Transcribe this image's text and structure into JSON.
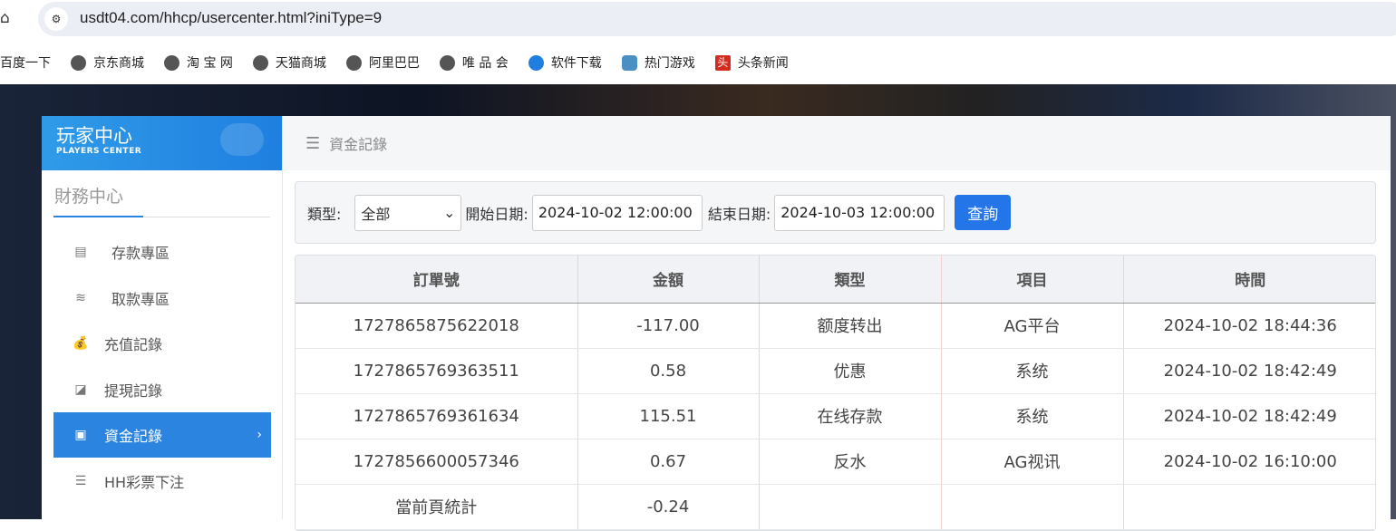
{
  "browser": {
    "url": "usdt04.com/hhcp/usercenter.html?iniType=9",
    "bookmarks": [
      "百度一下",
      "京东商城",
      "淘 宝 网",
      "天猫商城",
      "阿里巴巴",
      "唯 品 会",
      "软件下载",
      "热门游戏",
      "头条新闻"
    ]
  },
  "sidebar": {
    "brand_title": "玩家中心",
    "brand_sub": "PLAYERS CENTER",
    "section": "財務中心",
    "items": [
      {
        "label": "存款專區",
        "icon": "card-icon"
      },
      {
        "label": "取款專區",
        "icon": "hand-cash-icon"
      },
      {
        "label": "充值記錄",
        "icon": "money-bag-icon"
      },
      {
        "label": "提現記錄",
        "icon": "wallet-icon"
      },
      {
        "label": "資金記錄",
        "icon": "safe-icon",
        "active": true
      },
      {
        "label": "HH彩票下注",
        "icon": "list-icon"
      }
    ]
  },
  "header": {
    "title": "資金記錄"
  },
  "filter": {
    "type_label": "類型:",
    "type_value": "全部",
    "start_label": "開始日期:",
    "start_value": "2024-10-02 12:00:00",
    "end_label": "結束日期:",
    "end_value": "2024-10-03 12:00:00",
    "query": "查詢"
  },
  "table": {
    "columns": [
      "訂單號",
      "金額",
      "類型",
      "項目",
      "時間"
    ],
    "rows": [
      [
        "1727865875622018",
        "-117.00",
        "额度转出",
        "AG平台",
        "2024-10-02 18:44:36"
      ],
      [
        "1727865769363511",
        "0.58",
        "优惠",
        "系统",
        "2024-10-02 18:42:49"
      ],
      [
        "1727865769361634",
        "115.51",
        "在线存款",
        "系统",
        "2024-10-02 18:42:49"
      ],
      [
        "1727856600057346",
        "0.67",
        "反水",
        "AG视讯",
        "2024-10-02 16:10:00"
      ]
    ],
    "summary": {
      "label": "當前頁統計",
      "amount": "-0.24"
    }
  },
  "colors": {
    "accent": "#2a84e0",
    "button": "#2476e8"
  }
}
